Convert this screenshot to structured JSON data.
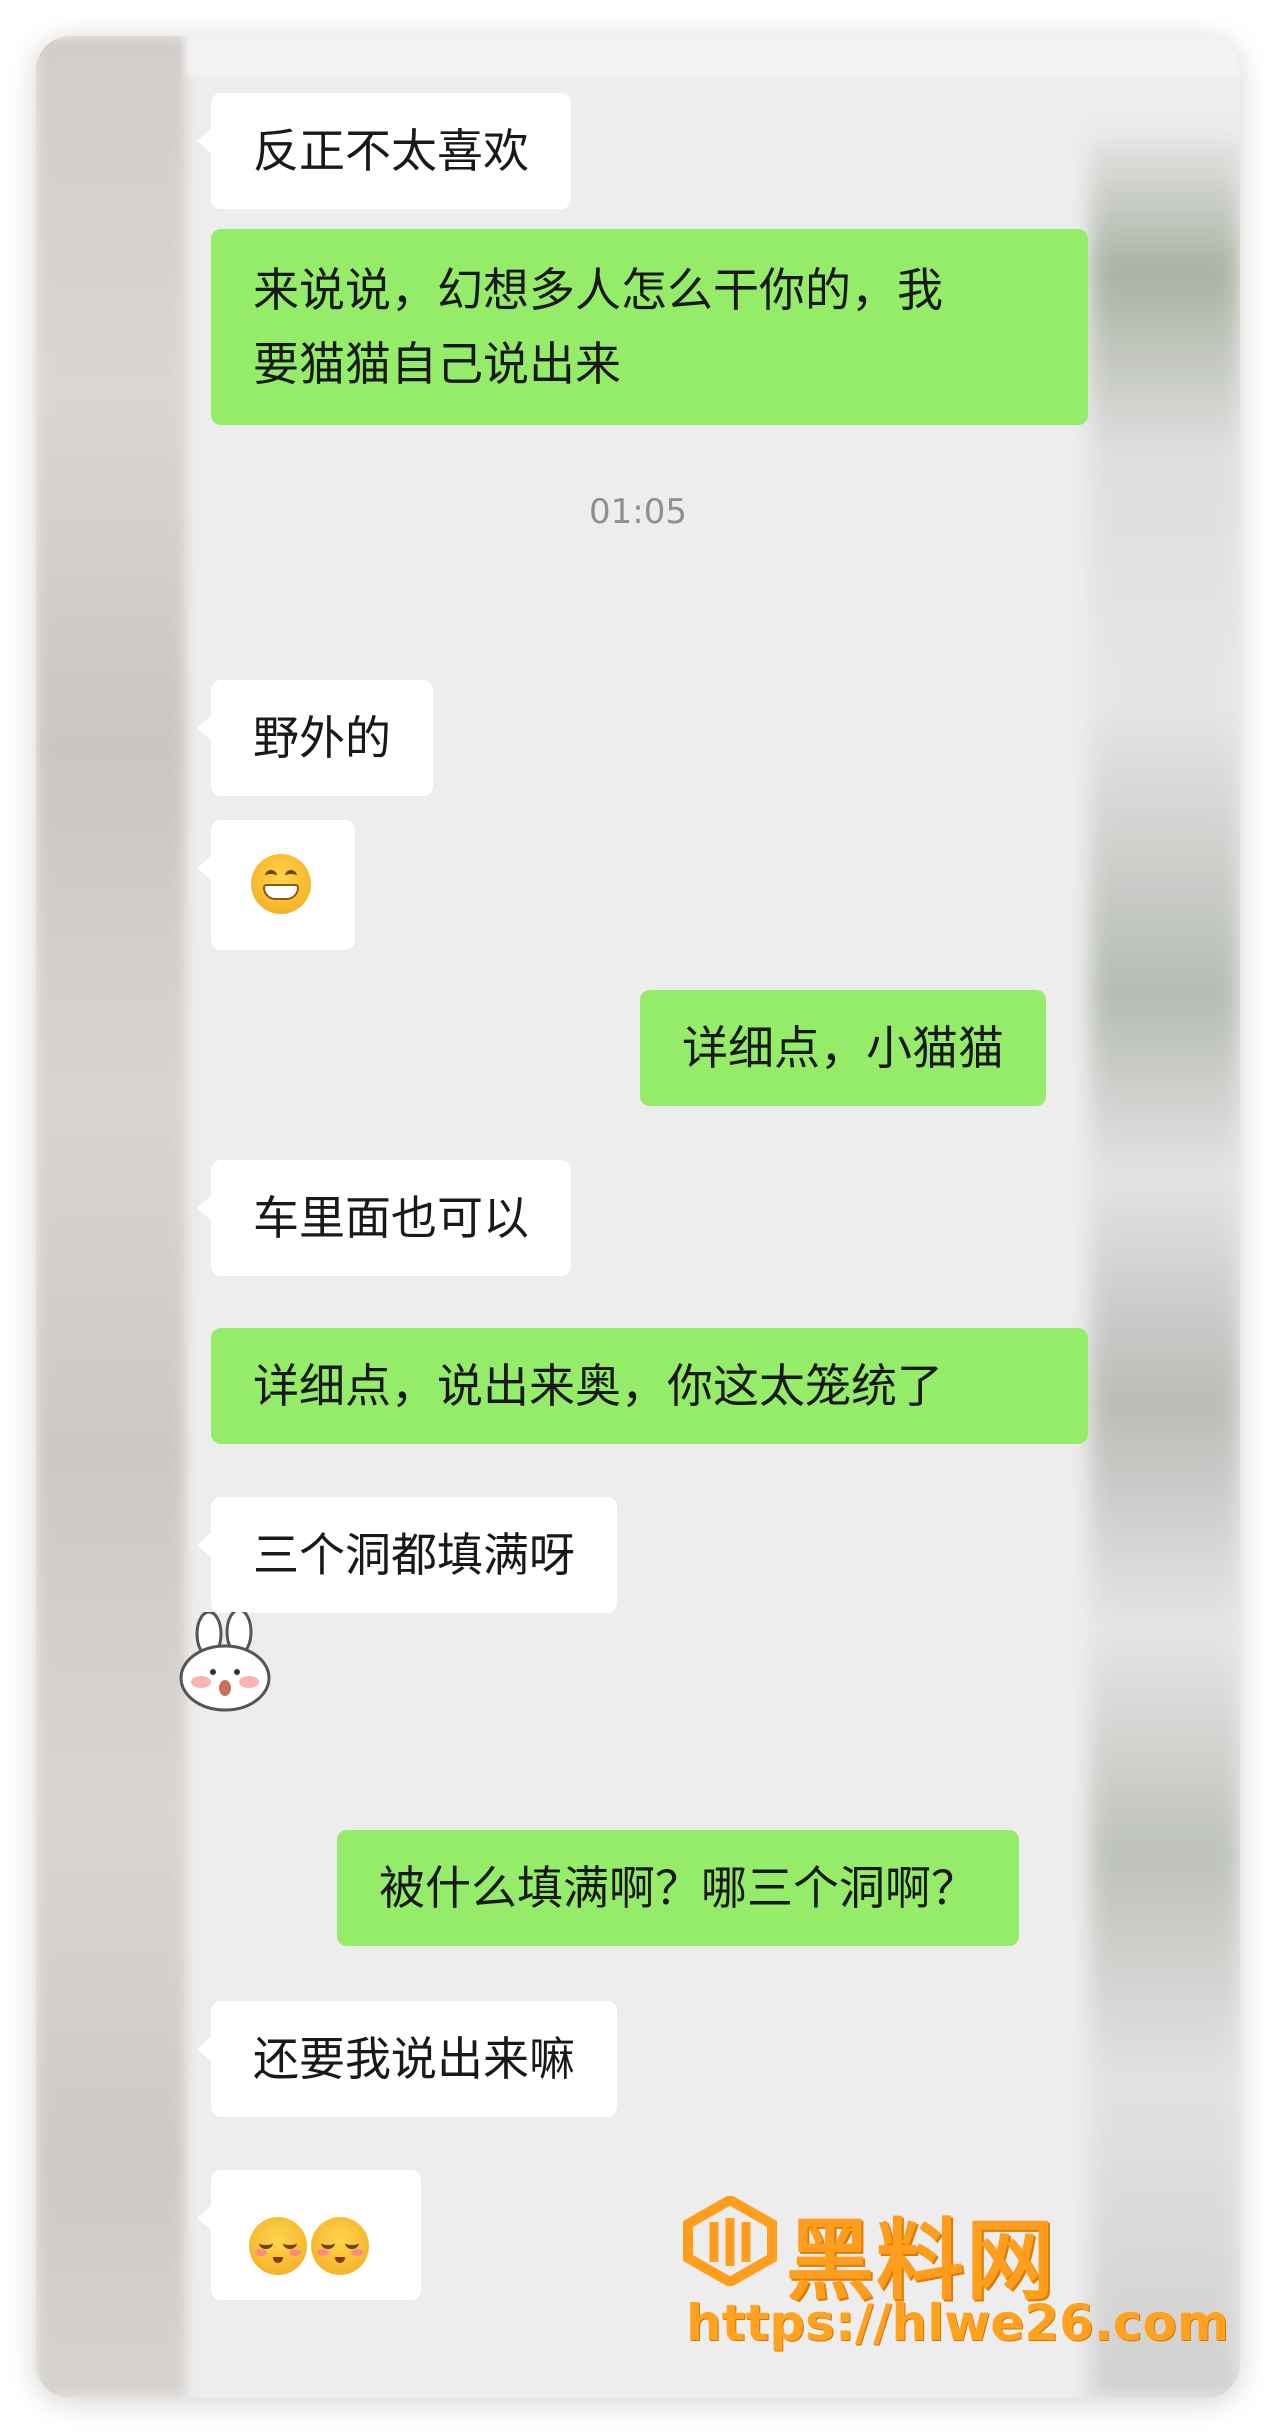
{
  "messages": [
    {
      "id": "m1",
      "side": "in",
      "text": "反正不太喜欢"
    },
    {
      "id": "m2",
      "side": "out",
      "line1": "来说说，幻想多人怎么干你的，我",
      "line2": "要猫猫自己说出来"
    },
    {
      "id": "m3",
      "side": "in",
      "text": "野外的"
    },
    {
      "id": "m4",
      "side": "in",
      "emoji": "grinning-face-icon"
    },
    {
      "id": "m5",
      "side": "out",
      "text": "详细点，小猫猫"
    },
    {
      "id": "m6",
      "side": "in",
      "text": "车里面也可以"
    },
    {
      "id": "m7",
      "side": "out",
      "text": "详细点，说出来奥，你这太笼统了"
    },
    {
      "id": "m8",
      "side": "in",
      "text": "三个洞都填满呀"
    },
    {
      "id": "m9",
      "side": "in",
      "sticker": "rabbit-sticker-icon"
    },
    {
      "id": "m10",
      "side": "out",
      "text": "被什么填满啊？哪三个洞啊？"
    },
    {
      "id": "m11",
      "side": "in",
      "text": "还要我说出来嘛"
    },
    {
      "id": "m12",
      "side": "in",
      "emoji": "blushing-faces-icon"
    }
  ],
  "timestamp": "01:05",
  "watermark": {
    "title": "黑料网",
    "url": "https://hlwe26.com"
  },
  "colors": {
    "incoming": "#ffffff",
    "outgoing": "#95ec69",
    "background": "#ededed",
    "watermark": "#ff9d1c"
  }
}
